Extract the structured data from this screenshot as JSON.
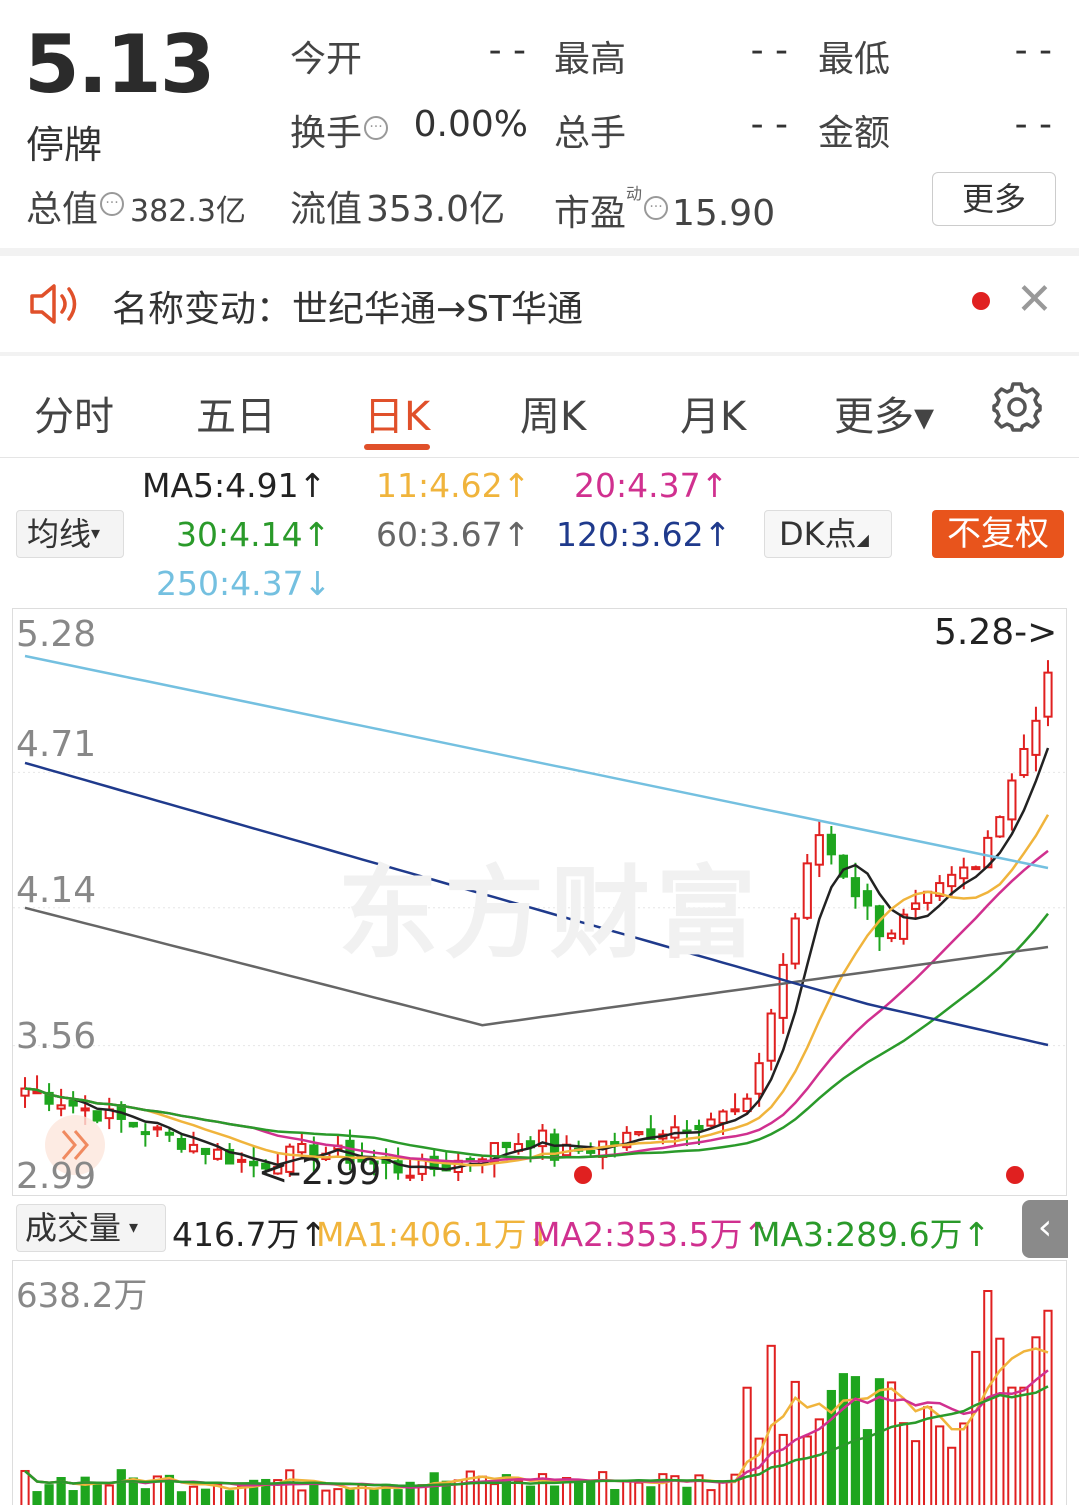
{
  "quote": {
    "price": "5.13",
    "status": "停牌",
    "open_label": "今开",
    "open_value": "- -",
    "high_label": "最高",
    "high_value": "- -",
    "low_label": "最低",
    "low_value": "- -",
    "turnover_label": "换手",
    "turnover_value": "0.00%",
    "total_hands_label": "总手",
    "total_hands_value": "- -",
    "amount_label": "金额",
    "amount_value": "- -",
    "total_cap_label": "总值",
    "total_cap_value": "382.3亿",
    "float_cap_label": "流值",
    "float_cap_value": "353.0亿",
    "pe_label": "市盈",
    "pe_sup": "动",
    "pe_value": "15.90",
    "more_label": "更多",
    "info_icon": "ellipsis-circle-icon"
  },
  "notice": {
    "text": "名称变动：世纪华通→ST华通",
    "icon": "speaker-icon",
    "dot_color": "#e02020"
  },
  "tabs": [
    {
      "label": "分时"
    },
    {
      "label": "五日"
    },
    {
      "label": "日K"
    },
    {
      "label": "周K"
    },
    {
      "label": "月K"
    },
    {
      "label": "更多▾"
    }
  ],
  "active_tab": "日K",
  "accent_color": "#e0502a",
  "ma_legend": {
    "selector_label": "均线",
    "items": [
      {
        "text": "MA5:4.91↑",
        "color": "#222222"
      },
      {
        "text": "11:4.62↑",
        "color": "#f0b43c"
      },
      {
        "text": "20:4.37↑",
        "color": "#d0308f"
      },
      {
        "text": "30:4.14↑",
        "color": "#2a9a2a"
      },
      {
        "text": "60:3.67↑",
        "color": "#666666"
      },
      {
        "text": "120:3.62↑",
        "color": "#1f3a8c"
      },
      {
        "text": "250:4.37↓",
        "color": "#74c0e0"
      }
    ],
    "dk_label": "DK点",
    "adjust_label": "不复权"
  },
  "chart_data": {
    "type": "candlestick",
    "price_ticks": [
      "5.28",
      "4.71",
      "4.14",
      "3.56",
      "2.99"
    ],
    "ylim": [
      2.99,
      5.28
    ],
    "max_label": "5.28",
    "min_label": "2.99",
    "watermark": "东方财富",
    "series": [
      {
        "name": "MA5",
        "color": "#222222"
      },
      {
        "name": "11",
        "color": "#f0b43c"
      },
      {
        "name": "20",
        "color": "#d0308f"
      },
      {
        "name": "30",
        "color": "#2a9a2a"
      },
      {
        "name": "60",
        "color": "#666666"
      },
      {
        "name": "120",
        "color": "#1f3a8c"
      },
      {
        "name": "250",
        "color": "#74c0e0"
      }
    ],
    "up_color": "#e02020",
    "down_color": "#1ea51e"
  },
  "volume": {
    "selector_label": "成交量",
    "value": "416.7万↑",
    "ma1": "MA1:406.1万↓",
    "ma2": "MA2:353.5万↑",
    "ma3": "MA3:289.6万↑",
    "max_tick": "638.2万"
  }
}
